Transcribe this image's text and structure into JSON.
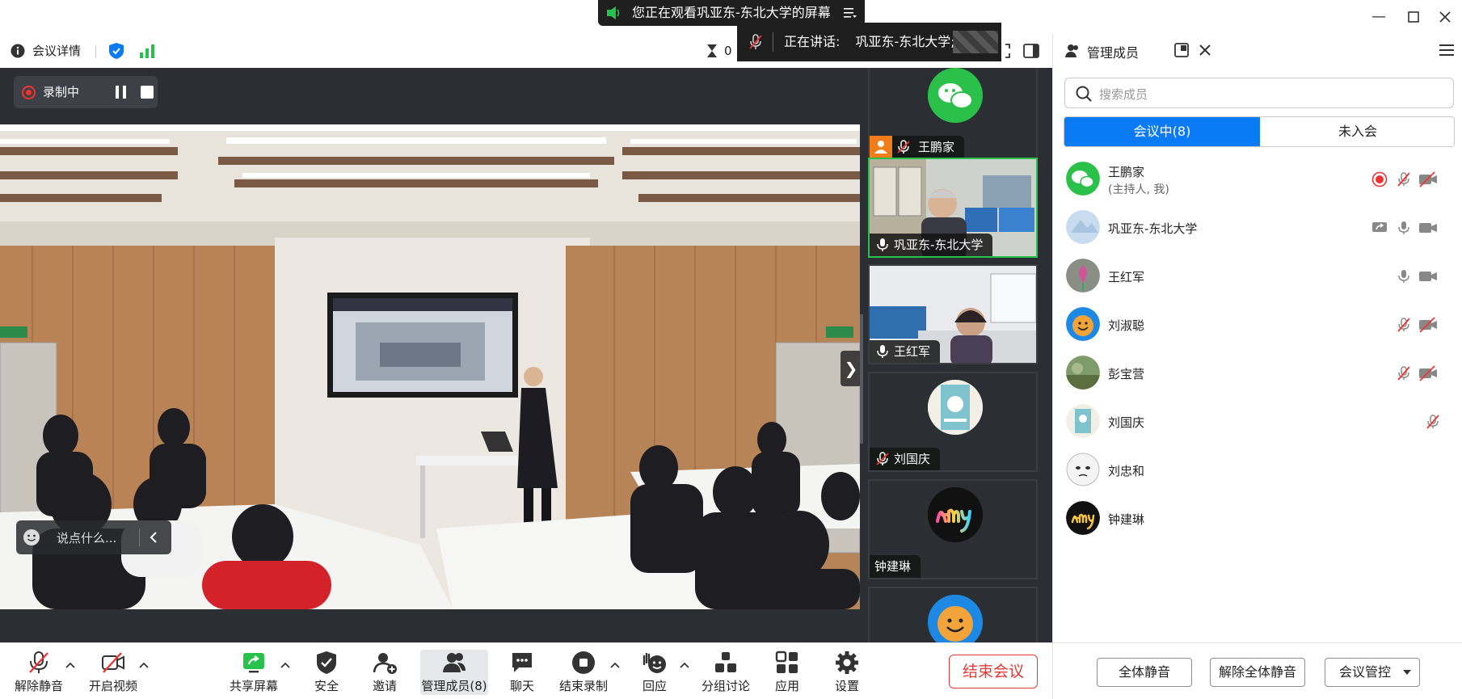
{
  "banner": {
    "text": "您正在观看巩亚东-东北大学的屏幕"
  },
  "infobar": {
    "meeting_details": "会议详情",
    "timer_prefix": "0",
    "speaking_label": "正在讲话:",
    "speaking_name": "巩亚东-东北大学;"
  },
  "recording": {
    "label": "录制中"
  },
  "chat": {
    "placeholder": "说点什么..."
  },
  "thumbnails": [
    {
      "name": "王鹏家"
    },
    {
      "name": "巩亚东-东北大学"
    },
    {
      "name": "王红军"
    },
    {
      "name": "刘国庆"
    },
    {
      "name": "钟建琳"
    }
  ],
  "toolbar": {
    "unmute": "解除静音",
    "start_video": "开启视频",
    "share_screen": "共享屏幕",
    "security": "安全",
    "invite": "邀请",
    "manage_members": "管理成员(8)",
    "chat": "聊天",
    "end_recording": "结束录制",
    "reactions": "回应",
    "breakout": "分组讨论",
    "apps": "应用",
    "settings": "设置",
    "end_meeting": "结束会议"
  },
  "panel": {
    "title": "管理成员",
    "search_placeholder": "搜索成员",
    "tab_in_meeting": "会议中(8)",
    "tab_not_joined": "未入会",
    "members": [
      {
        "name": "王鹏家",
        "sub": "(主持人, 我)"
      },
      {
        "name": "巩亚东-东北大学"
      },
      {
        "name": "王红军"
      },
      {
        "name": "刘淑聪"
      },
      {
        "name": "彭宝营"
      },
      {
        "name": "刘国庆"
      },
      {
        "name": "刘忠和"
      },
      {
        "name": "钟建琳"
      }
    ],
    "mute_all": "全体静音",
    "unmute_all": "解除全体静音",
    "meeting_control": "会议管控"
  },
  "colors": {
    "accent": "#0a7bf5",
    "end": "#e53935",
    "active_speaker": "#27c24c",
    "rec": "#e33333"
  }
}
